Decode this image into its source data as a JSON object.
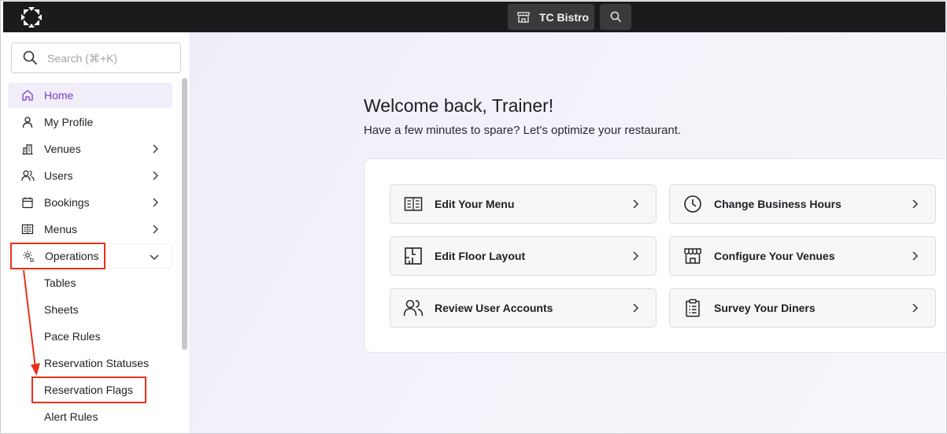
{
  "topbar": {
    "venue_name": "TC Bistro"
  },
  "sidebar": {
    "search_placeholder": "Search (⌘+K)",
    "items": [
      {
        "label": "Home",
        "icon": "home-icon"
      },
      {
        "label": "My Profile",
        "icon": "user-icon"
      },
      {
        "label": "Venues",
        "icon": "building-icon"
      },
      {
        "label": "Users",
        "icon": "users-icon"
      },
      {
        "label": "Bookings",
        "icon": "calendar-icon"
      },
      {
        "label": "Menus",
        "icon": "menu-book-icon"
      },
      {
        "label": "Operations",
        "icon": "gear-list-icon"
      }
    ],
    "operations_sub": [
      "Tables",
      "Sheets",
      "Pace Rules",
      "Reservation Statuses",
      "Reservation Flags",
      "Alert Rules"
    ]
  },
  "main": {
    "welcome": "Welcome back, Trainer!",
    "subtitle": "Have a few minutes to spare? Let's optimize your restaurant.",
    "actions": [
      {
        "label": "Edit Your Menu",
        "icon": "menu-icon"
      },
      {
        "label": "Change Business Hours",
        "icon": "clock-icon"
      },
      {
        "label": "Edit Floor Layout",
        "icon": "floor-plan-icon"
      },
      {
        "label": "Configure Your Venues",
        "icon": "storefront-icon"
      },
      {
        "label": "Review User Accounts",
        "icon": "users-icon"
      },
      {
        "label": "Survey Your Diners",
        "icon": "clipboard-icon"
      }
    ]
  },
  "colors": {
    "accent": "#7a3cc8",
    "highlight": "#e8321c",
    "topbar": "#1b1b1d"
  }
}
